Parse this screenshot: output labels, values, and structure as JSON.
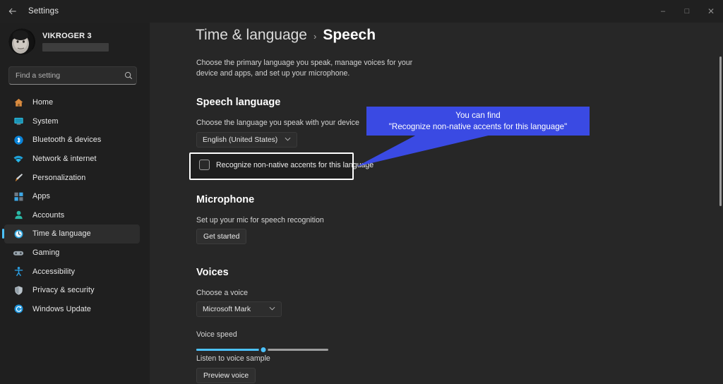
{
  "titlebar": {
    "back_icon": "back-arrow-icon",
    "title": "Settings",
    "minimize": "–",
    "maximize": "□",
    "close": "✕"
  },
  "sidebar": {
    "profile": {
      "name": "VIKROGER 3",
      "account_redacted": ""
    },
    "search": {
      "placeholder": "Find a setting",
      "value": "",
      "icon": "search-icon"
    },
    "items": [
      {
        "label": "Home",
        "icon": "home-icon",
        "active": false
      },
      {
        "label": "System",
        "icon": "system-icon",
        "active": false
      },
      {
        "label": "Bluetooth & devices",
        "icon": "bluetooth-icon",
        "active": false
      },
      {
        "label": "Network & internet",
        "icon": "network-icon",
        "active": false
      },
      {
        "label": "Personalization",
        "icon": "paintbrush-icon",
        "active": false
      },
      {
        "label": "Apps",
        "icon": "apps-icon",
        "active": false
      },
      {
        "label": "Accounts",
        "icon": "accounts-icon",
        "active": false
      },
      {
        "label": "Time & language",
        "icon": "clock-icon",
        "active": true
      },
      {
        "label": "Gaming",
        "icon": "gamepad-icon",
        "active": false
      },
      {
        "label": "Accessibility",
        "icon": "accessibility-icon",
        "active": false
      },
      {
        "label": "Privacy & security",
        "icon": "shield-icon",
        "active": false
      },
      {
        "label": "Windows Update",
        "icon": "update-icon",
        "active": false
      }
    ]
  },
  "main": {
    "breadcrumb": {
      "parent": "Time & language",
      "separator": "›",
      "current": "Speech"
    },
    "description": "Choose the primary language you speak, manage voices for your device and apps, and set up your microphone.",
    "speech_language": {
      "heading": "Speech language",
      "field_label": "Choose the language you speak with your device",
      "selected": "English (United States)",
      "chevron": "⌄",
      "checkbox_label": "Recognize non-native accents for this language",
      "checkbox_checked": false
    },
    "microphone": {
      "heading": "Microphone",
      "field_label": "Set up your mic for speech recognition",
      "button": "Get started"
    },
    "voices": {
      "heading": "Voices",
      "field_label": "Choose a voice",
      "selected": "Microsoft Mark",
      "chevron": "⌄",
      "speed_label": "Voice speed",
      "speed_percent": 51,
      "sample_label": "Listen to voice sample",
      "preview_button": "Preview voice"
    }
  },
  "callout": {
    "line1": "You can find",
    "line2": "\"Recognize non-native accents for this language\"",
    "color": "#3a4ae3"
  },
  "colors": {
    "accent": "#4cc2ff",
    "window_bg": "#1f1f1f",
    "content_bg": "#272727",
    "highlight_border": "#ffffff"
  }
}
